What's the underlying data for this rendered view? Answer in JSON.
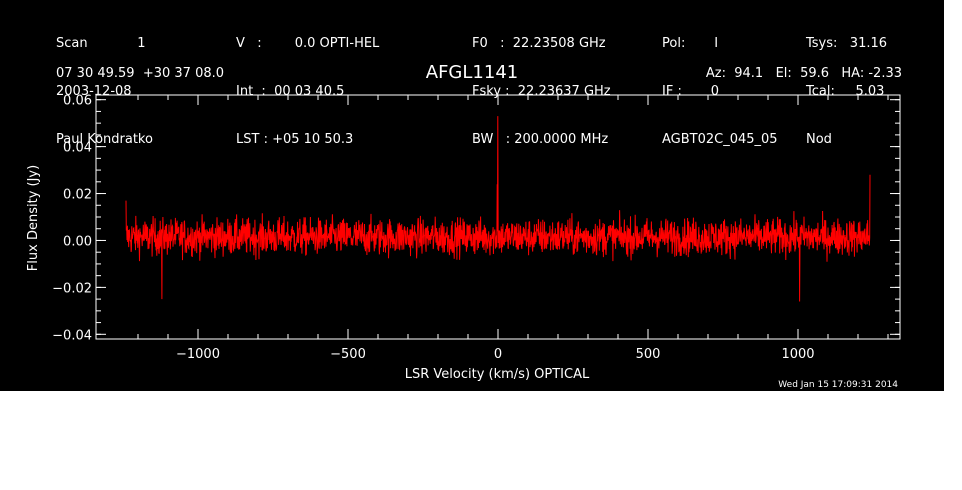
{
  "header": {
    "col1": [
      "Scan            1",
      "2003-12-08",
      "Paul Kondratko"
    ],
    "col2": [
      "V   :        0.0 OPTI-HEL",
      "Int  :  00 03 40.5",
      "LST : +05 10 50.3"
    ],
    "col3": [
      "F0   :  22.23508 GHz",
      "Fsky :  22.23637 GHz",
      "BW   : 200.0000 MHz"
    ],
    "col4": [
      "Pol:       I",
      "IF :       0",
      "AGBT02C_045_05"
    ],
    "col5": [
      "Tsys:   31.16",
      "Tcal:     5.03",
      "Nod"
    ]
  },
  "coords": "07 30 49.59  +30 37 08.0",
  "source": "AFGL1141",
  "azel": "Az:  94.1   El:  59.6   HA: -2.33",
  "timestamp": "Wed Jan 15 17:09:31 2014",
  "chart_data": {
    "type": "line",
    "title": "AFGL1141",
    "xlabel": "LSR Velocity (km/s) OPTICAL",
    "ylabel": "Flux Density (Jy)",
    "xlim": [
      -1340,
      1340
    ],
    "ylim": [
      -0.042,
      0.062
    ],
    "xticks": [
      -1000,
      -500,
      0,
      500,
      1000
    ],
    "xtick_labels": [
      "−1000",
      "−500",
      "0",
      "500",
      "1000"
    ],
    "yticks": [
      -0.04,
      -0.02,
      0.0,
      0.02,
      0.04,
      0.06
    ],
    "ytick_labels": [
      "−0.04",
      "−0.02",
      "0.00",
      "0.02",
      "0.04",
      "0.06"
    ],
    "grid": false,
    "line_color": "#ff0000",
    "series": [
      {
        "x_range": [
          -1240,
          1240
        ],
        "noise_band": [
          -0.012,
          0.015
        ],
        "peaks": [
          {
            "x": 0,
            "y": 0.053
          },
          {
            "x": -3,
            "y": 0.024
          },
          {
            "x": 1240,
            "y": 0.028
          },
          {
            "x": -1120,
            "y": -0.025
          },
          {
            "x": 1005,
            "y": -0.026
          },
          {
            "x": -1245,
            "y": 0.017
          }
        ]
      }
    ]
  }
}
